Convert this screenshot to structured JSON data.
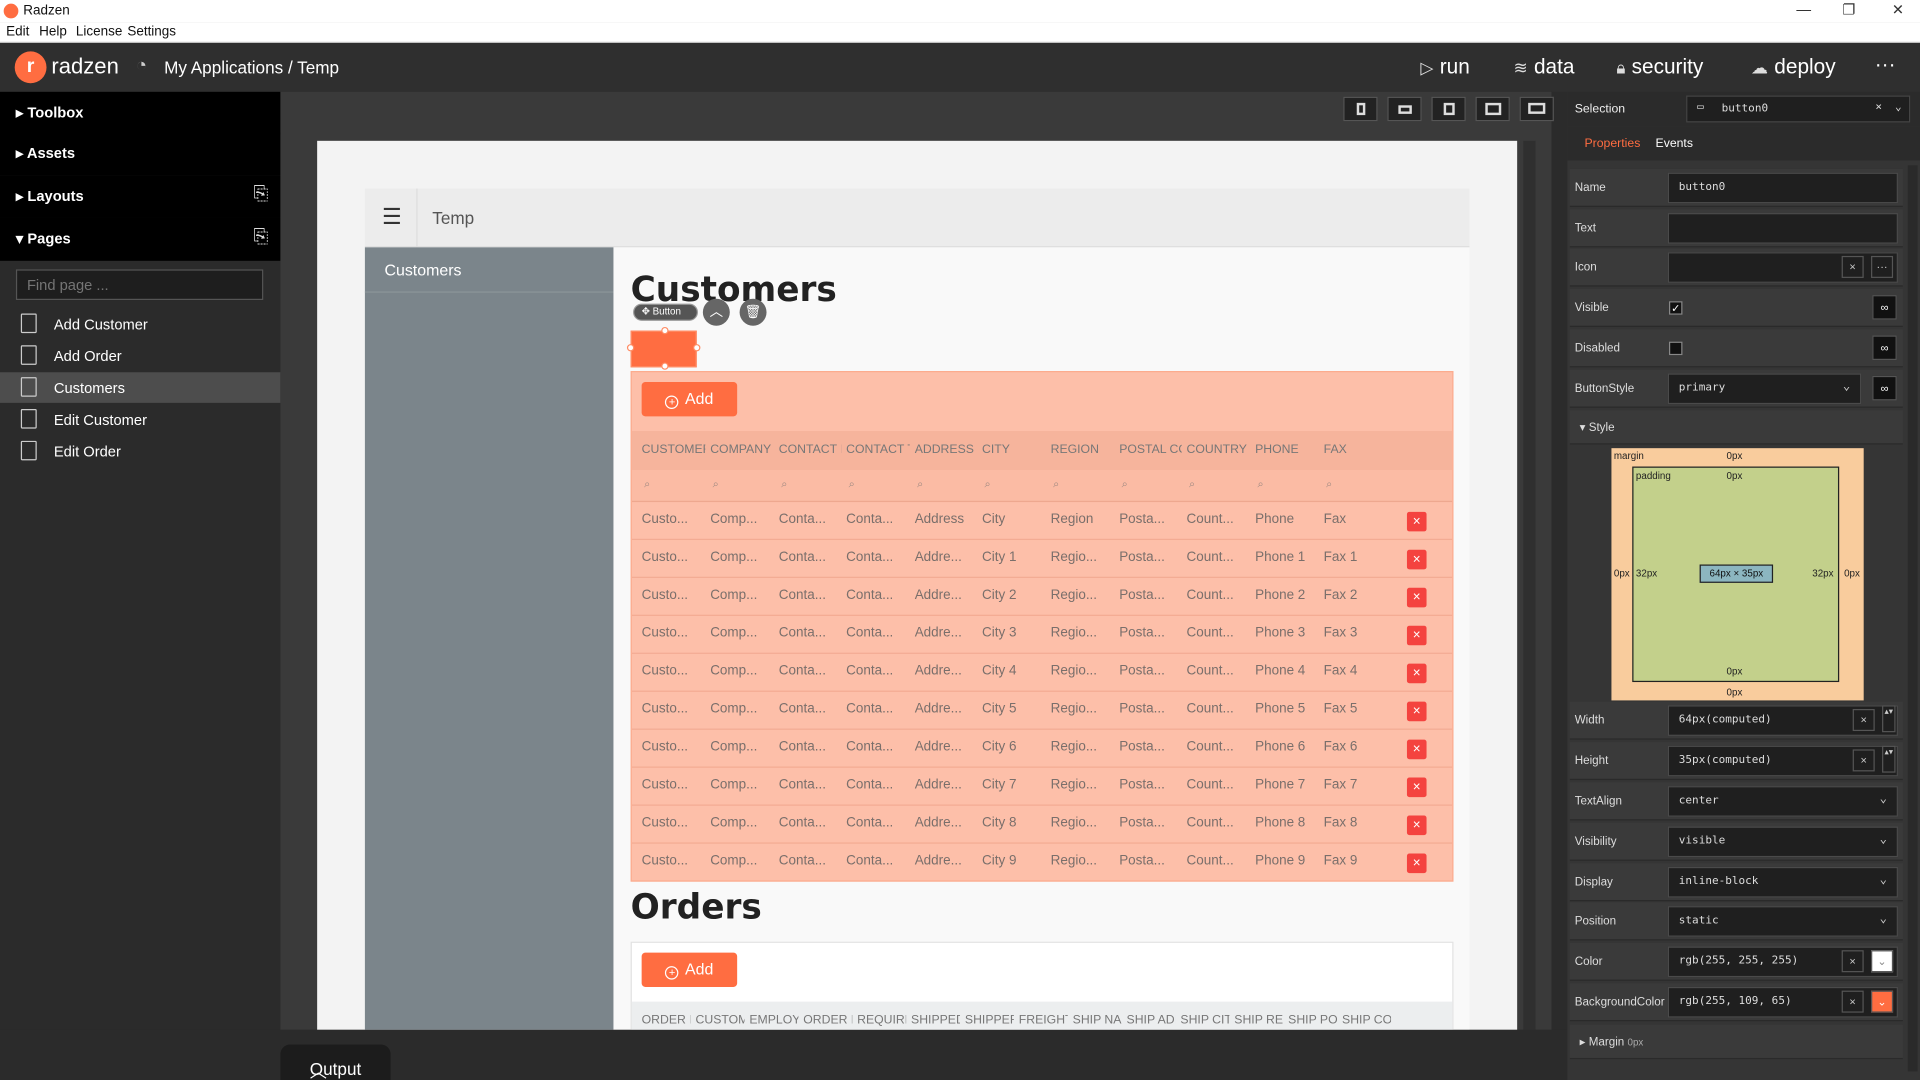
{
  "window": {
    "title": "Radzen",
    "controls": [
      "—",
      "❐",
      "✕"
    ]
  },
  "menubar": [
    "Edit",
    "Help",
    "License",
    "Settings"
  ],
  "topbar": {
    "brand": "radzen",
    "breadcrumb": "My Applications / Temp",
    "nav": [
      {
        "icon": "play-icon",
        "glyph": "▷",
        "label": "run"
      },
      {
        "icon": "layers-icon",
        "glyph": "≋",
        "label": "data"
      },
      {
        "icon": "lock-icon",
        "glyph": "🔒︎",
        "label": "security"
      },
      {
        "icon": "cloud-upload-icon",
        "glyph": "☁",
        "label": "deploy"
      }
    ],
    "more": "···"
  },
  "sidebar": {
    "sections": [
      "Toolbox",
      "Assets",
      "Layouts",
      "Pages"
    ],
    "find_placeholder": "Find page ...",
    "pages": [
      "Add Customer",
      "Add Order",
      "Customers",
      "Edit Customer",
      "Edit Order"
    ],
    "selected_page": "Customers"
  },
  "designer": {
    "header_title": "Temp",
    "nav_item": "Customers",
    "customers_heading": "Customers",
    "orders_heading": "Orders",
    "add_label": "Add",
    "selection_tag": "Button",
    "customers_columns": [
      "CUSTOMER",
      "COMPANY N",
      "CONTACT N",
      "CONTACT T",
      "ADDRESS",
      "CITY",
      "REGION",
      "POSTAL CO",
      "COUNTRY",
      "PHONE",
      "FAX"
    ],
    "customers_rows": [
      [
        "Custo...",
        "Comp...",
        "Conta...",
        "Conta...",
        "Address",
        "City",
        "Region",
        "Posta...",
        "Count...",
        "Phone",
        "Fax"
      ],
      [
        "Custo...",
        "Comp...",
        "Conta...",
        "Conta...",
        "Addre...",
        "City 1",
        "Regio...",
        "Posta...",
        "Count...",
        "Phone 1",
        "Fax 1"
      ],
      [
        "Custo...",
        "Comp...",
        "Conta...",
        "Conta...",
        "Addre...",
        "City 2",
        "Regio...",
        "Posta...",
        "Count...",
        "Phone 2",
        "Fax 2"
      ],
      [
        "Custo...",
        "Comp...",
        "Conta...",
        "Conta...",
        "Addre...",
        "City 3",
        "Regio...",
        "Posta...",
        "Count...",
        "Phone 3",
        "Fax 3"
      ],
      [
        "Custo...",
        "Comp...",
        "Conta...",
        "Conta...",
        "Addre...",
        "City 4",
        "Regio...",
        "Posta...",
        "Count...",
        "Phone 4",
        "Fax 4"
      ],
      [
        "Custo...",
        "Comp...",
        "Conta...",
        "Conta...",
        "Addre...",
        "City 5",
        "Regio...",
        "Posta...",
        "Count...",
        "Phone 5",
        "Fax 5"
      ],
      [
        "Custo...",
        "Comp...",
        "Conta...",
        "Conta...",
        "Addre...",
        "City 6",
        "Regio...",
        "Posta...",
        "Count...",
        "Phone 6",
        "Fax 6"
      ],
      [
        "Custo...",
        "Comp...",
        "Conta...",
        "Conta...",
        "Addre...",
        "City 7",
        "Regio...",
        "Posta...",
        "Count...",
        "Phone 7",
        "Fax 7"
      ],
      [
        "Custo...",
        "Comp...",
        "Conta...",
        "Conta...",
        "Addre...",
        "City 8",
        "Regio...",
        "Posta...",
        "Count...",
        "Phone 8",
        "Fax 8"
      ],
      [
        "Custo...",
        "Comp...",
        "Conta...",
        "Conta...",
        "Addre...",
        "City 9",
        "Regio...",
        "Posta...",
        "Count...",
        "Phone 9",
        "Fax 9"
      ]
    ],
    "orders_columns": [
      "ORDER II",
      "CUSTOM",
      "EMPLOY",
      "ORDER D",
      "REQUIRE",
      "SHIPPED",
      "SHIPPER",
      "FREIGHT",
      "SHIP NAI",
      "SHIP ADI",
      "SHIP CIT",
      "SHIP REC",
      "SHIP PO",
      "SHIP COI"
    ],
    "accent_color": "#ff6d41"
  },
  "output_tab": "Output",
  "properties": {
    "selection_label": "Selection",
    "selection_value": "button0",
    "tabs": [
      "Properties",
      "Events"
    ],
    "name": {
      "label": "Name",
      "value": "button0"
    },
    "text": {
      "label": "Text",
      "value": ""
    },
    "icon": {
      "label": "Icon",
      "value": ""
    },
    "visible": {
      "label": "Visible",
      "checked": true
    },
    "disabled": {
      "label": "Disabled",
      "checked": false
    },
    "button_style": {
      "label": "ButtonStyle",
      "value": "primary"
    },
    "style_section": "Style",
    "box": {
      "margin_label": "margin",
      "padding_label": "padding",
      "margin": "0px",
      "padding_lr": "32px",
      "padding_tb": "0px",
      "content": "64px × 35px"
    },
    "width": {
      "label": "Width",
      "value": "64px(computed)"
    },
    "height": {
      "label": "Height",
      "value": "35px(computed)"
    },
    "text_align": {
      "label": "TextAlign",
      "value": "center"
    },
    "visibility": {
      "label": "Visibility",
      "value": "visible"
    },
    "display": {
      "label": "Display",
      "value": "inline-block"
    },
    "position": {
      "label": "Position",
      "value": "static"
    },
    "color": {
      "label": "Color",
      "value": "rgb(255, 255, 255)",
      "swatch": "#ffffff"
    },
    "background_color": {
      "label": "BackgroundColor",
      "value": "rgb(255, 109, 65)",
      "swatch": "#ff6d41"
    },
    "margin_section": "Margin",
    "margin_value": "0px"
  }
}
